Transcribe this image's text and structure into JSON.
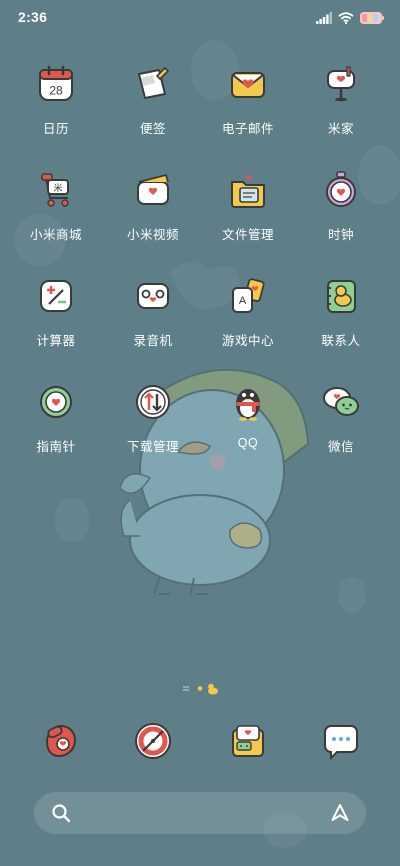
{
  "status_bar": {
    "time": "2:36",
    "icons": [
      "signal-icon",
      "wifi-icon",
      "battery-icon"
    ]
  },
  "apps": [
    {
      "name": "calendar",
      "label": "日历",
      "icon": "calendar-icon",
      "icon_text": "28"
    },
    {
      "name": "notes",
      "label": "便签",
      "icon": "notes-icon"
    },
    {
      "name": "email",
      "label": "电子邮件",
      "icon": "email-icon"
    },
    {
      "name": "mi-home",
      "label": "米家",
      "icon": "mailbox-icon"
    },
    {
      "name": "mi-store",
      "label": "小米商城",
      "icon": "shopping-cart-icon",
      "icon_text": "米"
    },
    {
      "name": "mi-video",
      "label": "小米视频",
      "icon": "video-icon"
    },
    {
      "name": "file-manager",
      "label": "文件管理",
      "icon": "folder-icon"
    },
    {
      "name": "clock",
      "label": "时钟",
      "icon": "stopwatch-icon"
    },
    {
      "name": "calculator",
      "label": "计算器",
      "icon": "calculator-icon"
    },
    {
      "name": "recorder",
      "label": "录音机",
      "icon": "recorder-icon"
    },
    {
      "name": "game-center",
      "label": "游戏中心",
      "icon": "game-card-icon",
      "icon_text": "A"
    },
    {
      "name": "contacts",
      "label": "联系人",
      "icon": "contacts-book-icon"
    },
    {
      "name": "compass",
      "label": "指南针",
      "icon": "compass-icon"
    },
    {
      "name": "downloads",
      "label": "下载管理",
      "icon": "download-icon"
    },
    {
      "name": "qq",
      "label": "QQ",
      "icon": "penguin-icon"
    },
    {
      "name": "wechat",
      "label": "微信",
      "icon": "chat-bubbles-icon"
    }
  ],
  "page_indicator": {
    "pages": 3,
    "current": 2
  },
  "dock": [
    {
      "name": "phone",
      "icon": "phone-icon"
    },
    {
      "name": "browser",
      "icon": "compass-browser-icon"
    },
    {
      "name": "messages",
      "icon": "message-folder-icon"
    },
    {
      "name": "chat",
      "icon": "speech-bubble-icon"
    }
  ],
  "search": {
    "icon": "search-icon",
    "assistant_icon": "assistant-icon"
  },
  "colors": {
    "wallpaper": "#5f7f88",
    "icon_bg": "#ffffff",
    "accent_red": "#e0574f",
    "accent_yellow": "#f2c94c",
    "label_text": "#ffffff"
  }
}
